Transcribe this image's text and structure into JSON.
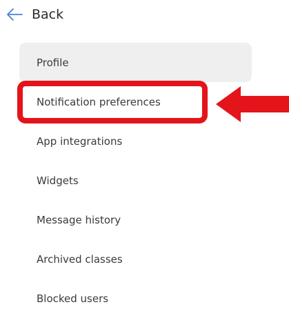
{
  "header": {
    "back_label": "Back",
    "back_icon": "arrow-left-icon"
  },
  "menu": {
    "items": [
      {
        "label": "Profile",
        "selected": true
      },
      {
        "label": "Notification preferences",
        "selected": false
      },
      {
        "label": "App integrations",
        "selected": false
      },
      {
        "label": "Widgets",
        "selected": false
      },
      {
        "label": "Message history",
        "selected": false
      },
      {
        "label": "Archived classes",
        "selected": false
      },
      {
        "label": "Blocked users",
        "selected": false
      }
    ]
  },
  "annotation": {
    "target": "Notification preferences",
    "color": "#e4141b"
  },
  "colors": {
    "accent": "#4a7fd6",
    "selected_bg": "#efefef",
    "text": "#3a3a3a",
    "annotation": "#e4141b"
  }
}
